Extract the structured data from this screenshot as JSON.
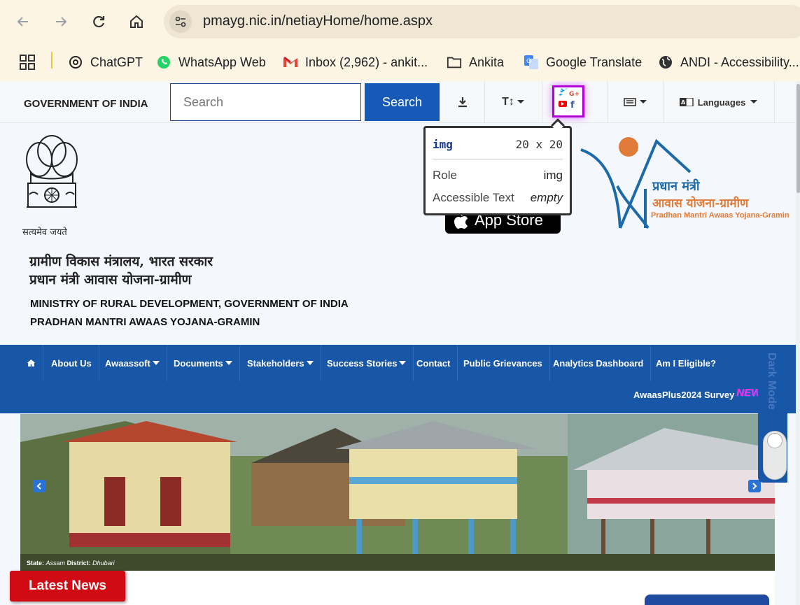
{
  "browser": {
    "url": "pmayg.nic.in/netiayHome/home.aspx",
    "bookmarks": [
      {
        "label": "ChatGPT",
        "icon": "chatgpt-icon"
      },
      {
        "label": "WhatsApp Web",
        "icon": "whatsapp-icon"
      },
      {
        "label": "Inbox (2,962) - ankit...",
        "icon": "gmail-icon"
      },
      {
        "label": "Ankita",
        "icon": "folder-icon"
      },
      {
        "label": "Google Translate",
        "icon": "google-translate-icon"
      },
      {
        "label": "ANDI - Accessibility...",
        "icon": "globe-icon"
      }
    ]
  },
  "topbar": {
    "gov_label": "GOVERNMENT OF INDIA",
    "search_placeholder": "Search",
    "search_button": "Search",
    "languages": "Languages"
  },
  "tooltip": {
    "tag": "img",
    "size": "20 x 20",
    "role_label": "Role",
    "role_value": "img",
    "text_label": "Accessible Text",
    "text_value": "empty"
  },
  "header": {
    "emblem_motto": "सत्यमेव जयते",
    "hindi_line1": "ग्रामीण विकास मंत्रालय, भारत सरकार",
    "hindi_line2": "प्रधान मंत्री आवास योजना-ग्रामीण",
    "eng_line1": "MINISTRY OF RURAL DEVELOPMENT, GOVERNMENT OF INDIA",
    "eng_line2": "PRADHAN MANTRI AWAAS YOJANA-GRAMIN",
    "app_store": "App Store",
    "logo_hindi1": "प्रधान मंत्री",
    "logo_hindi2": "आवास योजना-ग्रामीण",
    "logo_eng": "Pradhan Mantri Awaas Yojana-Gramin"
  },
  "nav": {
    "items": [
      "About Us",
      "Awaassoft",
      "Documents",
      "Stakeholders",
      "Success Stories",
      "Contact",
      "Public Grievances",
      "Analytics Dashboard",
      "Am I Eligible?"
    ],
    "survey": "AwaasPlus2024 Survey",
    "new_badge": "NEW"
  },
  "carousel": {
    "state_label": "State:",
    "state": "Assam",
    "district_label": "District:",
    "district": "Dhubari"
  },
  "dark_mode": "Dark Mode",
  "latest_news": "Latest News"
}
